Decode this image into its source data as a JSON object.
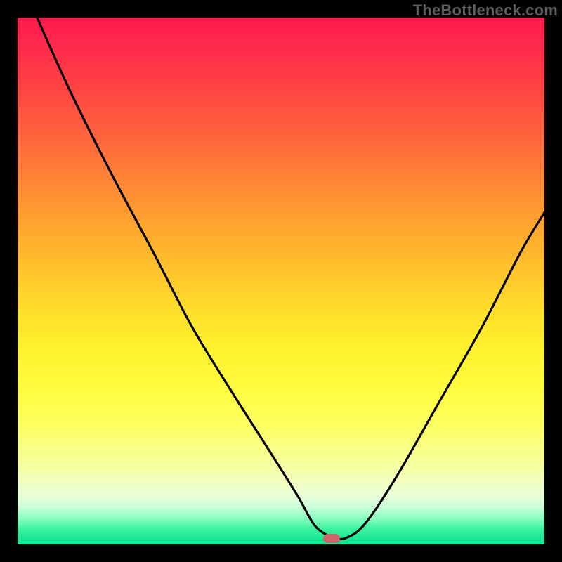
{
  "watermark": "TheBottleneck.com",
  "marker": {
    "cx_frac": 0.596,
    "cy_frac": 0.989
  },
  "chart_data": {
    "type": "line",
    "title": "",
    "xlabel": "",
    "ylabel": "",
    "xlim": [
      0,
      1
    ],
    "ylim": [
      0,
      1
    ],
    "series": [
      {
        "name": "bottleneck-curve",
        "x": [
          0.037,
          0.1,
          0.18,
          0.26,
          0.33,
          0.4,
          0.47,
          0.53,
          0.565,
          0.6,
          0.625,
          0.66,
          0.72,
          0.8,
          0.88,
          0.955,
          1.0
        ],
        "y": [
          1.0,
          0.86,
          0.7,
          0.55,
          0.415,
          0.3,
          0.19,
          0.095,
          0.035,
          0.013,
          0.013,
          0.04,
          0.13,
          0.27,
          0.41,
          0.555,
          0.63
        ],
        "note": "x,y are fractions of plot interior; y=0 at bottom, y=1 at top"
      }
    ],
    "annotations": [
      {
        "type": "marker",
        "x": 0.596,
        "y": 0.011,
        "label": "optimal-point"
      }
    ]
  }
}
